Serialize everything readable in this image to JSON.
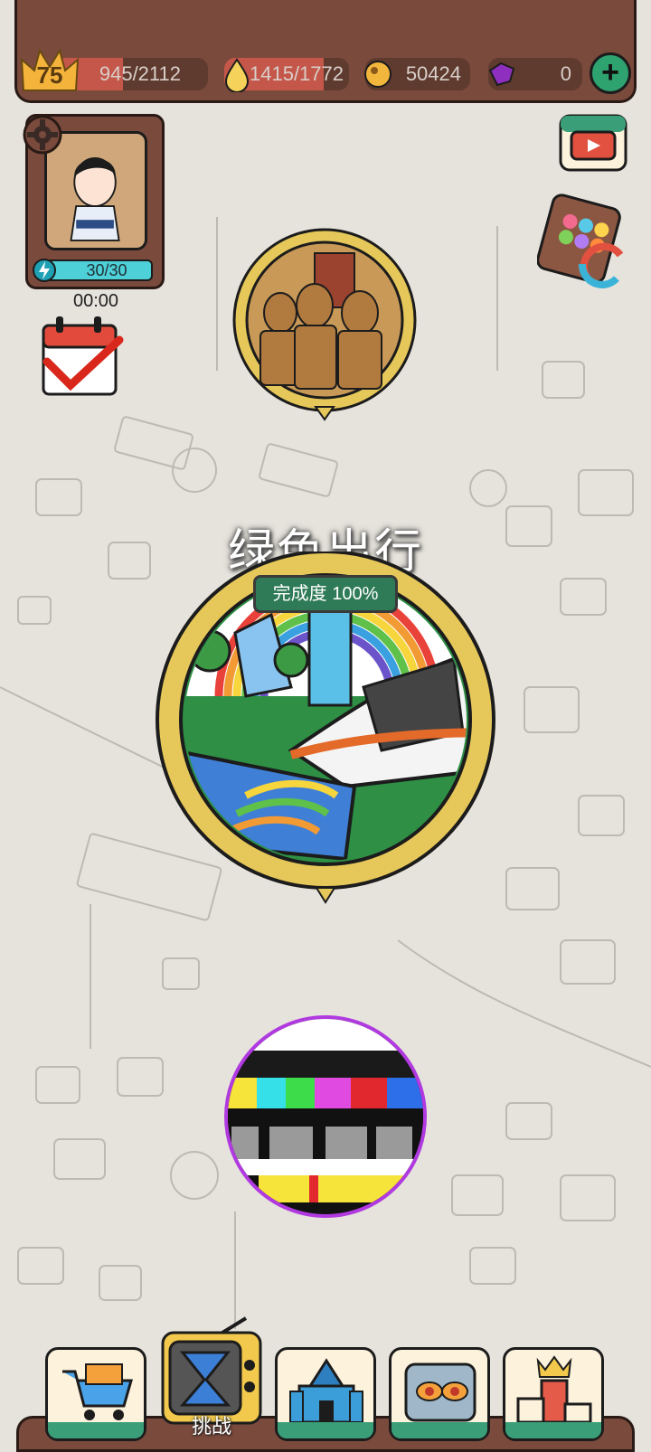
{
  "player": {
    "level": "75",
    "exp_text": "945/2112",
    "exp_fraction": 0.447,
    "stamina_text": "1415/1772",
    "stamina_fraction": 0.8,
    "coins_text": "50424",
    "gems_text": "0",
    "energy_text": "30/30",
    "timer_text": "00:00"
  },
  "main_chapter": {
    "title": "绿色出行",
    "progress_label": "完成度 100%",
    "progress_value": 100
  },
  "bottom_nav": {
    "active_label": "挑战",
    "items": [
      "shop",
      "challenge",
      "city",
      "monster",
      "ranking"
    ]
  },
  "colors": {
    "bar_bg": "#5e3a2f",
    "exp_fill": "#c4574a",
    "stamina_fill": "#c4574a",
    "accent_green": "#2fa36f",
    "energy": "#4dd0d7"
  }
}
